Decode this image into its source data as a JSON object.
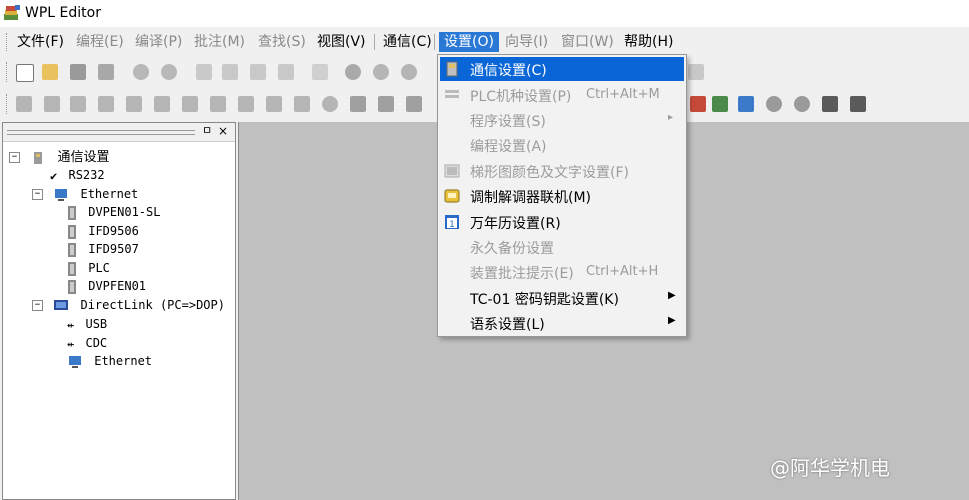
{
  "window": {
    "title": "WPL Editor"
  },
  "menubar": {
    "items": [
      {
        "label": "文件(F)"
      },
      {
        "label": "编程(E)"
      },
      {
        "label": "编译(P)"
      },
      {
        "label": "批注(M)"
      },
      {
        "label": "查找(S)"
      },
      {
        "label": "视图(V)"
      },
      {
        "label": "通信(C)"
      },
      {
        "label": "设置(O)"
      },
      {
        "label": "向导(I)"
      },
      {
        "label": "窗口(W)"
      },
      {
        "label": "帮助(H)"
      }
    ]
  },
  "settings_menu": {
    "items": [
      {
        "label": "通信设置(C)",
        "shortcut": "",
        "icon": "comm-settings-icon"
      },
      {
        "label": "PLC机种设置(P)",
        "shortcut": "Ctrl+Alt+M",
        "icon": "plc-model-icon"
      },
      {
        "label": "程序设置(S)",
        "shortcut": "",
        "icon": ""
      },
      {
        "label": "编程设置(A)",
        "shortcut": "",
        "icon": ""
      },
      {
        "label": "梯形图颜色及文字设置(F)",
        "shortcut": "",
        "icon": "ladder-color-icon"
      },
      {
        "label": "调制解调器联机(M)",
        "shortcut": "",
        "icon": "modem-icon"
      },
      {
        "label": "万年历设置(R)",
        "shortcut": "",
        "icon": "calendar-icon"
      },
      {
        "label": "永久备份设置",
        "shortcut": "",
        "icon": ""
      },
      {
        "label": "装置批注提示(E)",
        "shortcut": "Ctrl+Alt+H",
        "icon": ""
      },
      {
        "label": "TC-01 密码钥匙设置(K)",
        "shortcut": "",
        "icon": ""
      },
      {
        "label": "语系设置(L)",
        "shortcut": "",
        "icon": ""
      }
    ]
  },
  "tree": {
    "root": "通信设置",
    "rs232": "RS232",
    "ethernet": "Ethernet",
    "ethernet_children": [
      "DVPEN01-SL",
      "IFD9506",
      "IFD9507",
      "PLC",
      "DVPFEN01"
    ],
    "directlink": "DirectLink (PC=>DOP)",
    "directlink_children": [
      "USB",
      "CDC",
      "Ethernet"
    ]
  },
  "panel": {
    "pin": "ㅁ",
    "close": "×"
  },
  "watermark": "@阿华学机电",
  "colors": {
    "highlight": "#0a66d6",
    "workspace": "#c0c0c0"
  }
}
